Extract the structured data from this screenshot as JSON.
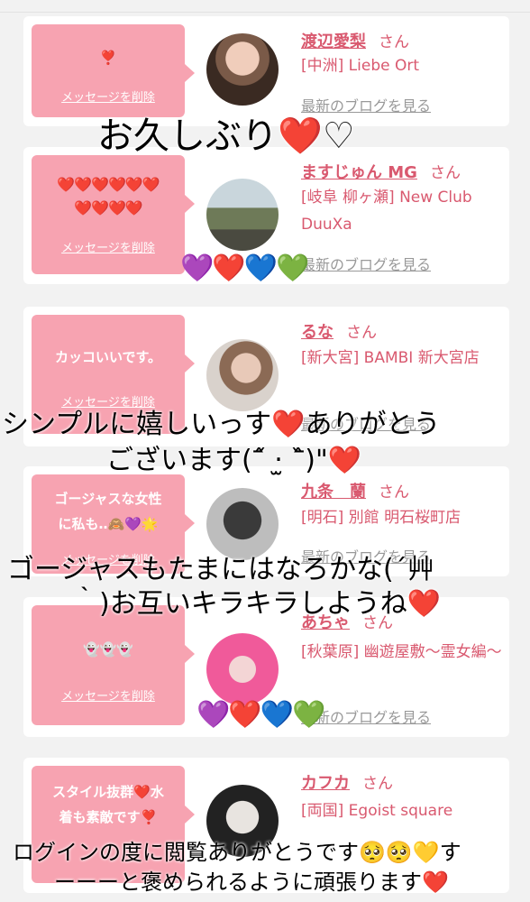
{
  "cards": [
    {
      "message": "❣️",
      "delete_label": "メッセージを削除",
      "name": "渡辺愛梨",
      "san": "さん",
      "shop": "[中洲] Liebe Ort",
      "blog_link": "最新のブログを見る"
    },
    {
      "message_line1": "❤️❤️❤️❤️❤️❤️",
      "message_line2": "❤️❤️❤️❤️",
      "delete_label": "メッセージを削除",
      "name": "ますじゅん MG",
      "san": "さん",
      "shop": "[岐阜 柳ヶ瀬] New Club DuuXa",
      "blog_link": "最新のブログを見る"
    },
    {
      "message": "カッコいいです。",
      "delete_label": "メッセージを削除",
      "name": "るな",
      "san": "さん",
      "shop": "[新大宮] BAMBI 新大宮店",
      "blog_link": "最新のブログを見る"
    },
    {
      "message_line1": "ゴージャスな女性",
      "message_line2": "に私も‥🙈💜🌟",
      "delete_label": "メッセージを削除",
      "name": "九条　蘭",
      "san": "さん",
      "shop": "[明石] 別館 明石桜町店",
      "blog_link": "最新のブログを見る"
    },
    {
      "message": "👻👻👻",
      "delete_label": "メッセージを削除",
      "name": "あちゃ",
      "san": "さん",
      "shop": "[秋葉原] 幽遊屋敷～霊女編～",
      "blog_link": "最新のブログを見る"
    },
    {
      "message_line1": "スタイル抜群❤️水",
      "message_line2": "着も素敵です❣️",
      "delete_label": "メッセージを削除",
      "name": "カフカ",
      "san": "さん",
      "shop": "[両国] Egoist square",
      "blog_link": "最新のブログを見る"
    }
  ],
  "overlays": {
    "o1_text": "お久しぶり",
    "o1_heart": "❤️",
    "o1_white": "♡",
    "o2_line1a": "シンプルに嬉しいっす",
    "o2_heart": "❤️",
    "o2_line1b": "ありがとう",
    "o2_line2": "ございます(ˆ᷄ ‧̫ ˆ᷅)\"",
    "o2_heart2": "❤️",
    "o3_line1": "ゴージャスもたまにはなろかな(´艸",
    "o3_line2": "｀)お互いキラキラしようね",
    "o3_heart": "❤️",
    "o4_line1": "ログインの度に閲覧ありがとうです🥺🥺💛す",
    "o4_line2": "ーーーと褒められるように頑張ります",
    "o4_heart": "❤️"
  },
  "heart_rows": {
    "row1": [
      "💜",
      "❤️",
      "💙",
      "💚"
    ],
    "row2": [
      "💜",
      "❤️",
      "💙",
      "💚"
    ]
  }
}
